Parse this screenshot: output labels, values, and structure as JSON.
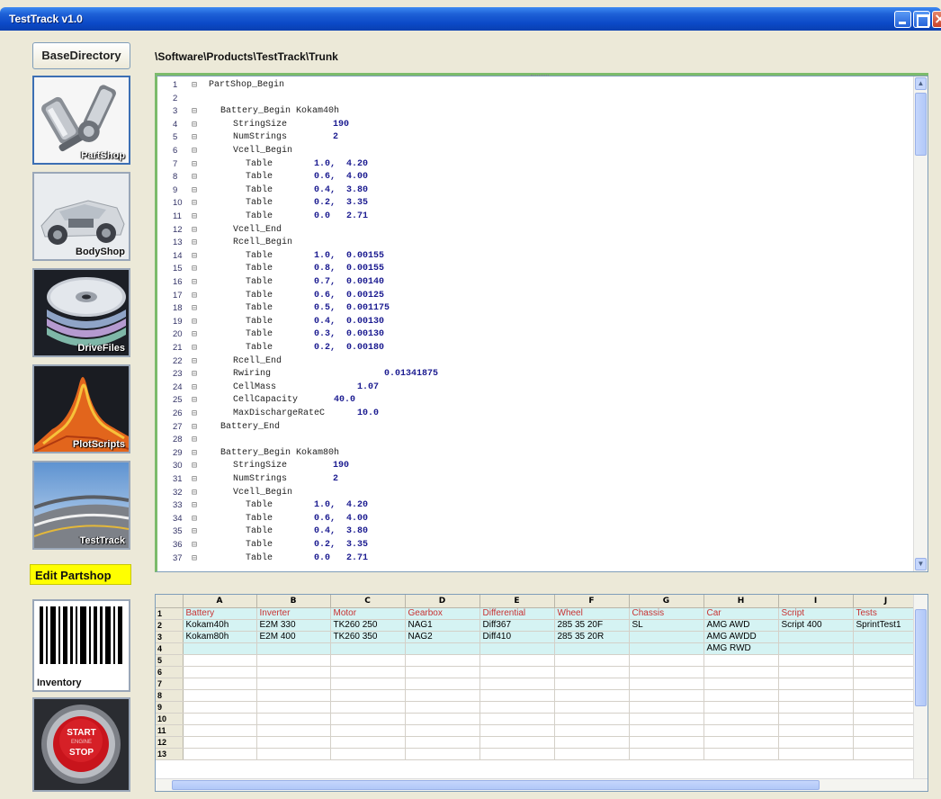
{
  "window": {
    "title": "TestTrack v1.0"
  },
  "base_directory_button": "BaseDirectory",
  "path": "\\Software\\Products\\TestTrack\\Trunk",
  "tiles": [
    {
      "label": "PartShop"
    },
    {
      "label": "BodyShop"
    },
    {
      "label": "DriveFiles"
    },
    {
      "label": "PlotScripts"
    },
    {
      "label": "TestTrack"
    }
  ],
  "edit_label": "Edit Partshop",
  "bottom_tiles": {
    "inventory": "Inventory",
    "start_text": "START",
    "engine_text": "ENGINE",
    "stop_text": "STOP"
  },
  "editor": {
    "lines": [
      {
        "n": "1",
        "fold": "⊟",
        "indent": 0,
        "text": "PartShop_Begin",
        "value": ""
      },
      {
        "n": "2",
        "fold": "",
        "indent": 0,
        "text": "",
        "value": ""
      },
      {
        "n": "3",
        "fold": "⊟",
        "indent": 1,
        "text": "Battery_Begin Kokam40h",
        "value": ""
      },
      {
        "n": "4",
        "fold": "⊟",
        "indent": 2,
        "text": "StringSize",
        "value": "190"
      },
      {
        "n": "5",
        "fold": "⊟",
        "indent": 2,
        "text": "NumStrings",
        "value": "2"
      },
      {
        "n": "6",
        "fold": "⊟",
        "indent": 2,
        "text": "Vcell_Begin",
        "value": ""
      },
      {
        "n": "7",
        "fold": "⊟",
        "indent": 3,
        "text": "Table",
        "value": "1.0,  4.20"
      },
      {
        "n": "8",
        "fold": "⊟",
        "indent": 3,
        "text": "Table",
        "value": "0.6,  4.00"
      },
      {
        "n": "9",
        "fold": "⊟",
        "indent": 3,
        "text": "Table",
        "value": "0.4,  3.80"
      },
      {
        "n": "10",
        "fold": "⊟",
        "indent": 3,
        "text": "Table",
        "value": "0.2,  3.35"
      },
      {
        "n": "11",
        "fold": "⊟",
        "indent": 3,
        "text": "Table",
        "value": "0.0   2.71"
      },
      {
        "n": "12",
        "fold": "⊟",
        "indent": 2,
        "text": "Vcell_End",
        "value": ""
      },
      {
        "n": "13",
        "fold": "⊟",
        "indent": 2,
        "text": "Rcell_Begin",
        "value": ""
      },
      {
        "n": "14",
        "fold": "⊟",
        "indent": 3,
        "text": "Table",
        "value": "1.0,  0.00155"
      },
      {
        "n": "15",
        "fold": "⊟",
        "indent": 3,
        "text": "Table",
        "value": "0.8,  0.00155"
      },
      {
        "n": "16",
        "fold": "⊟",
        "indent": 3,
        "text": "Table",
        "value": "0.7,  0.00140"
      },
      {
        "n": "17",
        "fold": "⊟",
        "indent": 3,
        "text": "Table",
        "value": "0.6,  0.00125"
      },
      {
        "n": "18",
        "fold": "⊟",
        "indent": 3,
        "text": "Table",
        "value": "0.5,  0.001175"
      },
      {
        "n": "19",
        "fold": "⊟",
        "indent": 3,
        "text": "Table",
        "value": "0.4,  0.00130"
      },
      {
        "n": "20",
        "fold": "⊟",
        "indent": 3,
        "text": "Table",
        "value": "0.3,  0.00130"
      },
      {
        "n": "21",
        "fold": "⊟",
        "indent": 3,
        "text": "Table",
        "value": "0.2,  0.00180"
      },
      {
        "n": "22",
        "fold": "⊟",
        "indent": 2,
        "text": "Rcell_End",
        "value": ""
      },
      {
        "n": "23",
        "fold": "⊟",
        "indent": 2,
        "text": "Rwiring",
        "value": "0.01341875",
        "far": true
      },
      {
        "n": "24",
        "fold": "⊟",
        "indent": 2,
        "text": "CellMass",
        "value": "1.07",
        "far": true
      },
      {
        "n": "25",
        "fold": "⊟",
        "indent": 2,
        "text": "CellCapacity",
        "value": "40.0",
        "mid": true
      },
      {
        "n": "26",
        "fold": "⊟",
        "indent": 2,
        "text": "MaxDischargeRateC",
        "value": "10.0",
        "mid": true
      },
      {
        "n": "27",
        "fold": "⊟",
        "indent": 1,
        "text": "Battery_End",
        "value": ""
      },
      {
        "n": "28",
        "fold": "⊟",
        "indent": 0,
        "text": "",
        "value": ""
      },
      {
        "n": "29",
        "fold": "⊟",
        "indent": 1,
        "text": "Battery_Begin Kokam80h",
        "value": ""
      },
      {
        "n": "30",
        "fold": "⊟",
        "indent": 2,
        "text": "StringSize",
        "value": "190"
      },
      {
        "n": "31",
        "fold": "⊟",
        "indent": 2,
        "text": "NumStrings",
        "value": "2"
      },
      {
        "n": "32",
        "fold": "⊟",
        "indent": 2,
        "text": "Vcell_Begin",
        "value": ""
      },
      {
        "n": "33",
        "fold": "⊟",
        "indent": 3,
        "text": "Table",
        "value": "1.0,  4.20"
      },
      {
        "n": "34",
        "fold": "⊟",
        "indent": 3,
        "text": "Table",
        "value": "0.6,  4.00"
      },
      {
        "n": "35",
        "fold": "⊟",
        "indent": 3,
        "text": "Table",
        "value": "0.4,  3.80"
      },
      {
        "n": "36",
        "fold": "⊟",
        "indent": 3,
        "text": "Table",
        "value": "0.2,  3.35"
      },
      {
        "n": "37",
        "fold": "⊟",
        "indent": 3,
        "text": "Table",
        "value": "0.0   2.71"
      }
    ]
  },
  "grid": {
    "columns": [
      "A",
      "B",
      "C",
      "D",
      "E",
      "F",
      "G",
      "H",
      "I",
      "J"
    ],
    "rows": [
      {
        "n": "1",
        "cells": [
          "Battery",
          "Inverter",
          "Motor",
          "Gearbox",
          "Differential",
          "Wheel",
          "Chassis",
          "Car",
          "Script",
          "Tests"
        ]
      },
      {
        "n": "2",
        "cells": [
          "Kokam40h",
          "E2M 330",
          "TK260 250",
          "NAG1",
          "Diff367",
          "285 35 20F",
          "SL",
          "AMG AWD",
          "Script 400",
          "SprintTest1"
        ]
      },
      {
        "n": "3",
        "cells": [
          "Kokam80h",
          "E2M 400",
          "TK260 350",
          "NAG2",
          "Diff410",
          "285 35 20R",
          "",
          "AMG AWDD",
          "",
          ""
        ]
      },
      {
        "n": "4",
        "cells": [
          "",
          "",
          "",
          "",
          "",
          "",
          "",
          "AMG RWD",
          "",
          ""
        ]
      },
      {
        "n": "5",
        "cells": [
          "",
          "",
          "",
          "",
          "",
          "",
          "",
          "",
          "",
          ""
        ]
      },
      {
        "n": "6",
        "cells": [
          "",
          "",
          "",
          "",
          "",
          "",
          "",
          "",
          "",
          ""
        ]
      },
      {
        "n": "7",
        "cells": [
          "",
          "",
          "",
          "",
          "",
          "",
          "",
          "",
          "",
          ""
        ]
      },
      {
        "n": "8",
        "cells": [
          "",
          "",
          "",
          "",
          "",
          "",
          "",
          "",
          "",
          ""
        ]
      },
      {
        "n": "9",
        "cells": [
          "",
          "",
          "",
          "",
          "",
          "",
          "",
          "",
          "",
          ""
        ]
      },
      {
        "n": "10",
        "cells": [
          "",
          "",
          "",
          "",
          "",
          "",
          "",
          "",
          "",
          ""
        ]
      },
      {
        "n": "11",
        "cells": [
          "",
          "",
          "",
          "",
          "",
          "",
          "",
          "",
          "",
          ""
        ]
      },
      {
        "n": "12",
        "cells": [
          "",
          "",
          "",
          "",
          "",
          "",
          "",
          "",
          "",
          ""
        ]
      },
      {
        "n": "13",
        "cells": [
          "",
          "",
          "",
          "",
          "",
          "",
          "",
          "",
          "",
          ""
        ]
      }
    ]
  }
}
